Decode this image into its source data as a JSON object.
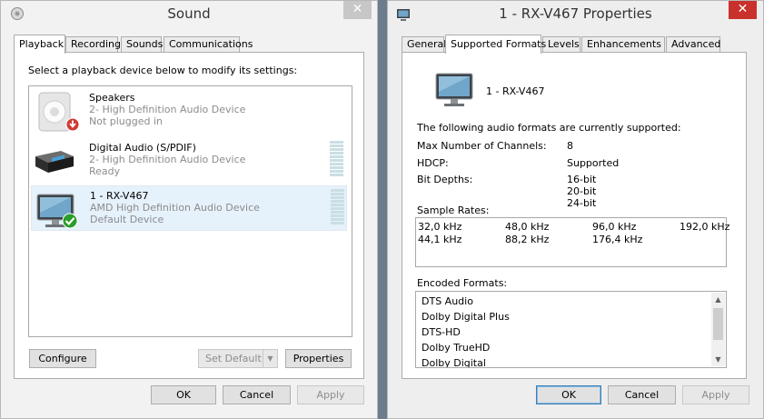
{
  "sound": {
    "title": "Sound",
    "close": "✕",
    "tabs": [
      "Playback",
      "Recording",
      "Sounds",
      "Communications"
    ],
    "instruction": "Select a playback device below to modify its settings:",
    "devices": [
      {
        "name": "Speakers",
        "line2": "2- High Definition Audio Device",
        "line3": "Not plugged in",
        "icon": "speaker-icon",
        "status": "unplugged"
      },
      {
        "name": "Digital Audio (S/PDIF)",
        "line2": "2- High Definition Audio Device",
        "line3": "Ready",
        "icon": "receiver-icon",
        "status": "ready"
      },
      {
        "name": "1 - RX-V467",
        "line2": "AMD High Definition Audio Device",
        "line3": "Default Device",
        "icon": "monitor-icon",
        "status": "default"
      }
    ],
    "buttons": {
      "configure": "Configure",
      "set_default": "Set Default",
      "properties": "Properties",
      "ok": "OK",
      "cancel": "Cancel",
      "apply": "Apply"
    }
  },
  "props": {
    "title": "1 - RX-V467 Properties",
    "close": "✕",
    "tabs": [
      "General",
      "Supported Formats",
      "Levels",
      "Enhancements",
      "Advanced"
    ],
    "device_name": "1 - RX-V467",
    "formats_intro": "The following audio formats are currently supported:",
    "max_channels_label": "Max Number of Channels:",
    "max_channels_value": "8",
    "hdcp_label": "HDCP:",
    "hdcp_value": "Supported",
    "bit_depths_label": "Bit Depths:",
    "bit_depths": [
      "16-bit",
      "20-bit",
      "24-bit"
    ],
    "sample_rates_label": "Sample Rates:",
    "sample_rates": [
      [
        "32,0 kHz",
        "48,0 kHz",
        "96,0 kHz",
        "192,0 kHz"
      ],
      [
        "44,1 kHz",
        "88,2 kHz",
        "176,4 kHz",
        ""
      ]
    ],
    "encoded_label": "Encoded Formats:",
    "encoded_formats": [
      "DTS Audio",
      "Dolby Digital Plus",
      "DTS-HD",
      "Dolby TrueHD",
      "Dolby Digital"
    ],
    "buttons": {
      "ok": "OK",
      "cancel": "Cancel",
      "apply": "Apply"
    }
  },
  "colors": {
    "accent": "#3c7fb1",
    "selection": "#e5f1fb",
    "close_red": "#c9312c",
    "check_green": "#2a9d2a"
  }
}
